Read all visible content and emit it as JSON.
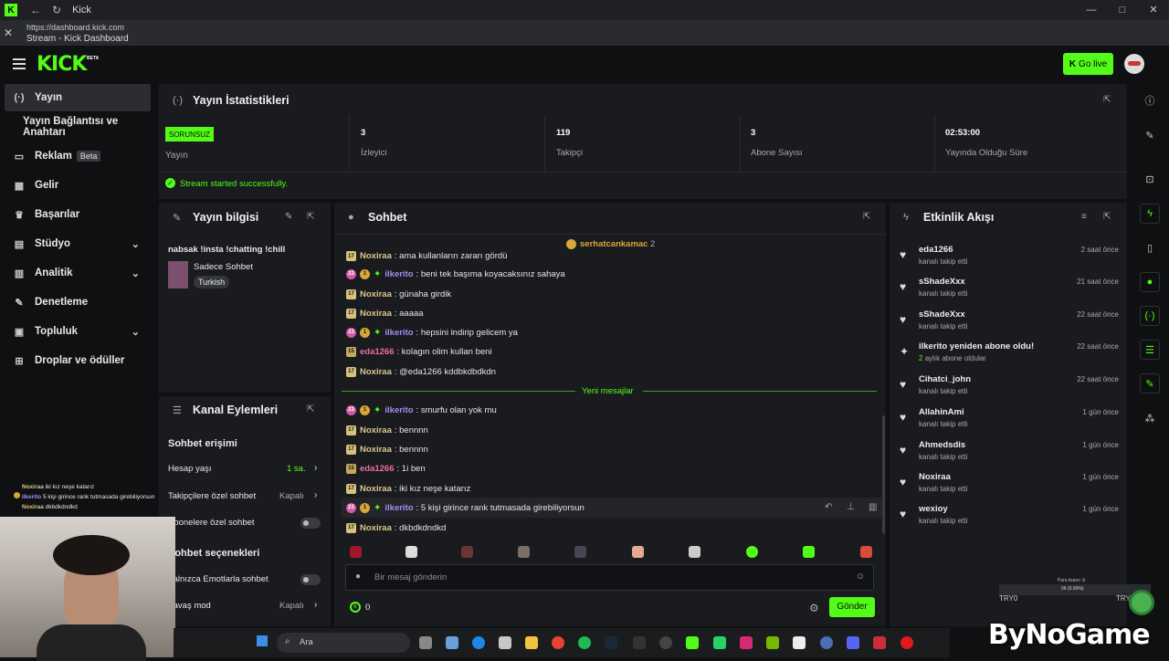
{
  "browser": {
    "tab_title": "Kick",
    "url": "https://dashboard.kick.com",
    "page_title": "Stream - Kick Dashboard"
  },
  "header": {
    "logo": "KICK",
    "beta": "BETA",
    "go_live": "Go live"
  },
  "sidebar": {
    "items": [
      {
        "label": "Yayın"
      },
      {
        "label": "Yayın Bağlantısı ve Anahtarı"
      },
      {
        "label": "Reklam",
        "badge": "Beta"
      },
      {
        "label": "Gelir"
      },
      {
        "label": "Başarılar"
      },
      {
        "label": "Stüdyo"
      },
      {
        "label": "Analitik"
      },
      {
        "label": "Denetleme"
      },
      {
        "label": "Topluluk"
      },
      {
        "label": "Droplar ve ödüller"
      }
    ]
  },
  "stats": {
    "title": "Yayın İstatistikleri",
    "status_badge": "SORUNSUZ",
    "status_label": "Yayın",
    "items": [
      {
        "value": "3",
        "label": "İzleyici"
      },
      {
        "value": "119",
        "label": "Takipçi"
      },
      {
        "value": "3",
        "label": "Abone Sayısı"
      },
      {
        "value": "02:53:00",
        "label": "Yayında Olduğu Süre"
      }
    ],
    "success_msg": "Stream started successfully."
  },
  "stream_info": {
    "title": "Yayın bilgisi",
    "stream_title": "nabsak !insta !chatting !chill",
    "category": "Sadece Sohbet",
    "tag": "Turkish"
  },
  "channel_actions": {
    "title": "Kanal Eylemleri",
    "chat_access": "Sohbet erişimi",
    "account_age": "Hesap yaşı",
    "account_age_val": "1 sa.",
    "followers_only": "Takipçilere özel sohbet",
    "followers_only_val": "Kapalı",
    "subs_only": "Abonelere özel sohbet",
    "chat_options": "Sohbet seçenekleri",
    "emote_only": "Yalnızca Emotlarla sohbet",
    "slow_mode": "Yavaş mod",
    "slow_mode_val": "Kapalı"
  },
  "chat": {
    "title": "Sohbet",
    "pinned_user": "serhatcankamac",
    "pinned_count": "2",
    "new_messages": "Yeni mesajlar",
    "messages": [
      {
        "user": "Noxiraa",
        "text": "ama kullanların zararı gördü"
      },
      {
        "user": "ilkerito",
        "text": "beni tek başıma koyacaksınız sahaya"
      },
      {
        "user": "Noxiraa",
        "text": "günaha girdik"
      },
      {
        "user": "Noxiraa",
        "text": "aaaaa"
      },
      {
        "user": "ilkerito",
        "text": "hepsini indirip gelicem ya"
      },
      {
        "user": "eda1266",
        "text": "kolagın olim kullan beni"
      },
      {
        "user": "Noxiraa",
        "text": "@eda1266 kddbkdbdkdn"
      },
      {
        "user": "ilkerito",
        "text": "smurfu olan yok mu"
      },
      {
        "user": "Noxiraa",
        "text": "bennnn"
      },
      {
        "user": "Noxiraa",
        "text": "bennnn"
      },
      {
        "user": "eda1266",
        "text": "1i ben"
      },
      {
        "user": "Noxiraa",
        "text": "iki kız neşe katarız"
      },
      {
        "user": "ilkerito",
        "text": "5 kişi girince rank tutmasada girebiliyorsun"
      },
      {
        "user": "Noxiraa",
        "text": "dkbdkdndkd"
      }
    ],
    "badges": {
      "sub17": "17",
      "sub15": "15",
      "sub23": "23",
      "one": "1"
    },
    "input_placeholder": "Bir mesaj gönderin",
    "kick_count": "0",
    "send": "Gönder"
  },
  "activity": {
    "title": "Etkinlik Akışı",
    "items": [
      {
        "name": "eda1266",
        "sub": "kanalı takip etti",
        "time": "2 saat önce"
      },
      {
        "name": "sShadeXxx",
        "sub": "kanalı takip etti",
        "time": "21 saat önce"
      },
      {
        "name": "sShadeXxx",
        "sub": "kanalı takip etti",
        "time": "22 saat önce"
      },
      {
        "name": "ilkerito yeniden abone oldu!",
        "sub_num": "2",
        "sub": "aylık abone oldular",
        "time": "22 saat önce"
      },
      {
        "name": "Cihatci_john",
        "sub": "kanalı takip etti",
        "time": "22 saat önce"
      },
      {
        "name": "AllahinAmi",
        "sub": "kanalı takip etti",
        "time": "1 gün önce"
      },
      {
        "name": "Ahmedsdis",
        "sub": "kanalı takip etti",
        "time": "1 gün önce"
      },
      {
        "name": "Noxiraa",
        "sub": "kanalı takip etti",
        "time": "1 gün önce"
      },
      {
        "name": "wexioy",
        "sub": "kanalı takip etti",
        "time": "1 gün önce"
      }
    ]
  },
  "overlay": {
    "chat_lines": [
      {
        "user": "Noxiraa",
        "text": "iki kız neşe katarız"
      },
      {
        "user": "ilkerito",
        "text": "5 kişi girince rank tutmasada girebiliyorsun"
      },
      {
        "user": "Noxiraa",
        "text": "dkbdkdndkd"
      }
    ],
    "brand": "ByNoGame",
    "ticker_left": "TRY0",
    "ticker_right": "TRY",
    "ticker_small": "06 (0.00%)",
    "ticker_top": "Para lisans :b"
  },
  "taskbar": {
    "search": "Ara"
  },
  "colors": {
    "accent": "#53fc18",
    "panel": "#191b1f",
    "background": "#0f1011"
  }
}
